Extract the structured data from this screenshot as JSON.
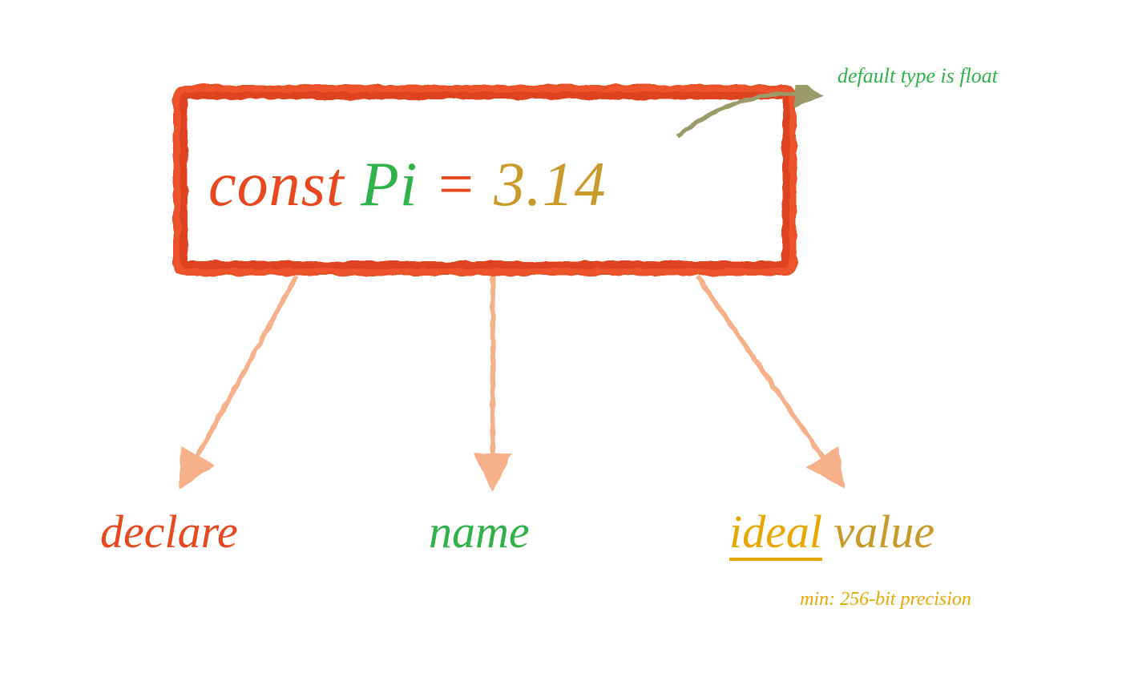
{
  "code": {
    "keyword": "const",
    "name": "Pi",
    "equals": "=",
    "value": "3.14"
  },
  "annotations": {
    "declare": "declare",
    "name": "name",
    "ideal": "ideal",
    "value_word": "value",
    "sub_note": "min: 256-bit precision",
    "type_note": "default type is float"
  },
  "colors": {
    "orange": "#e8481f",
    "green": "#2fb24a",
    "gold": "#c89a2a",
    "yellow": "#e6a800",
    "peach": "#f6b18a",
    "olive": "#9a9a6a"
  }
}
